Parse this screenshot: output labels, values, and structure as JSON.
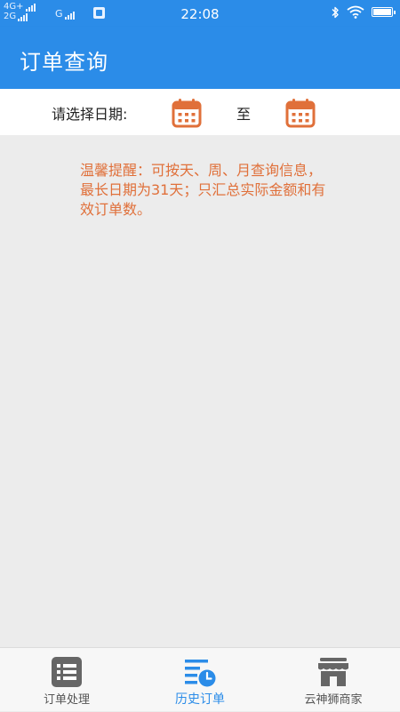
{
  "status_bar": {
    "network_top": "4G+",
    "network_bottom": "2G",
    "network_g": "G",
    "time": "22:08"
  },
  "app_bar": {
    "title": "订单查询"
  },
  "date_filter": {
    "label": "请选择日期:",
    "separator": "至"
  },
  "reminder": {
    "text": "温馨提醒：可按天、周、月查询信息，最长日期为31天；只汇总实际金额和有效订单数。"
  },
  "bottom_nav": {
    "items": [
      {
        "label": "订单处理",
        "icon": "list-icon"
      },
      {
        "label": "历史订单",
        "icon": "history-clock-icon",
        "active": true
      },
      {
        "label": "云神狮商家",
        "icon": "store-icon"
      }
    ]
  },
  "colors": {
    "primary": "#2b8ce8",
    "accent": "#e0703a",
    "background": "#ececec"
  }
}
